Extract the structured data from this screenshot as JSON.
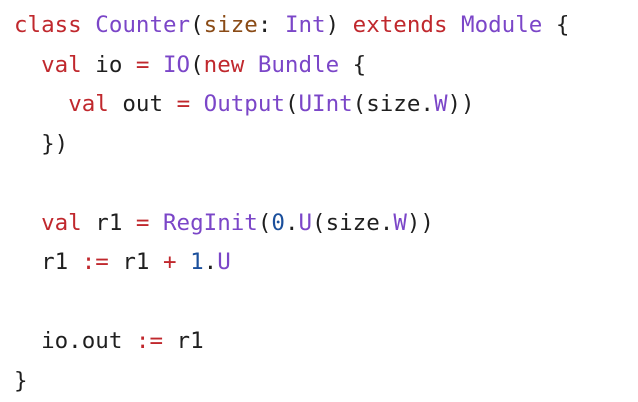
{
  "editor": {
    "colors": {
      "background": "#ffffff",
      "plain": "#1f1f1f",
      "keyword": "#c0282d",
      "type": "#7b46c8",
      "parameter": "#8a4b16",
      "number": "#1a4f9c"
    },
    "lines": [
      {
        "tokens": [
          {
            "t": "class",
            "k": "kw"
          },
          {
            "t": " ",
            "k": "txt"
          },
          {
            "t": "Counter",
            "k": "typ"
          },
          {
            "t": "(",
            "k": "txt"
          },
          {
            "t": "size",
            "k": "par"
          },
          {
            "t": ": ",
            "k": "txt"
          },
          {
            "t": "Int",
            "k": "typ"
          },
          {
            "t": ") ",
            "k": "txt"
          },
          {
            "t": "extends",
            "k": "kw"
          },
          {
            "t": " ",
            "k": "txt"
          },
          {
            "t": "Module",
            "k": "typ"
          },
          {
            "t": " {",
            "k": "txt"
          }
        ]
      },
      {
        "tokens": [
          {
            "t": "  ",
            "k": "txt"
          },
          {
            "t": "val",
            "k": "kw"
          },
          {
            "t": " io ",
            "k": "txt"
          },
          {
            "t": "=",
            "k": "kw"
          },
          {
            "t": " ",
            "k": "txt"
          },
          {
            "t": "IO",
            "k": "typ"
          },
          {
            "t": "(",
            "k": "txt"
          },
          {
            "t": "new",
            "k": "kw"
          },
          {
            "t": " ",
            "k": "txt"
          },
          {
            "t": "Bundle",
            "k": "typ"
          },
          {
            "t": " {",
            "k": "txt"
          }
        ]
      },
      {
        "tokens": [
          {
            "t": "    ",
            "k": "txt"
          },
          {
            "t": "val",
            "k": "kw"
          },
          {
            "t": " out ",
            "k": "txt"
          },
          {
            "t": "=",
            "k": "kw"
          },
          {
            "t": " ",
            "k": "txt"
          },
          {
            "t": "Output",
            "k": "typ"
          },
          {
            "t": "(",
            "k": "txt"
          },
          {
            "t": "UInt",
            "k": "typ"
          },
          {
            "t": "(size.",
            "k": "txt"
          },
          {
            "t": "W",
            "k": "typ"
          },
          {
            "t": "))",
            "k": "txt"
          }
        ]
      },
      {
        "tokens": [
          {
            "t": "  })",
            "k": "txt"
          }
        ]
      },
      {
        "tokens": []
      },
      {
        "tokens": [
          {
            "t": "  ",
            "k": "txt"
          },
          {
            "t": "val",
            "k": "kw"
          },
          {
            "t": " r1 ",
            "k": "txt"
          },
          {
            "t": "=",
            "k": "kw"
          },
          {
            "t": " ",
            "k": "txt"
          },
          {
            "t": "RegInit",
            "k": "typ"
          },
          {
            "t": "(",
            "k": "txt"
          },
          {
            "t": "0",
            "k": "num"
          },
          {
            "t": ".",
            "k": "txt"
          },
          {
            "t": "U",
            "k": "typ"
          },
          {
            "t": "(size.",
            "k": "txt"
          },
          {
            "t": "W",
            "k": "typ"
          },
          {
            "t": "))",
            "k": "txt"
          }
        ]
      },
      {
        "tokens": [
          {
            "t": "  r1 ",
            "k": "txt"
          },
          {
            "t": ":=",
            "k": "kw"
          },
          {
            "t": " r1 ",
            "k": "txt"
          },
          {
            "t": "+",
            "k": "kw"
          },
          {
            "t": " ",
            "k": "txt"
          },
          {
            "t": "1",
            "k": "num"
          },
          {
            "t": ".",
            "k": "txt"
          },
          {
            "t": "U",
            "k": "typ"
          }
        ]
      },
      {
        "tokens": []
      },
      {
        "tokens": [
          {
            "t": "  io.out ",
            "k": "txt"
          },
          {
            "t": ":=",
            "k": "kw"
          },
          {
            "t": " r1",
            "k": "txt"
          }
        ]
      },
      {
        "tokens": [
          {
            "t": "}",
            "k": "txt"
          }
        ]
      }
    ]
  }
}
